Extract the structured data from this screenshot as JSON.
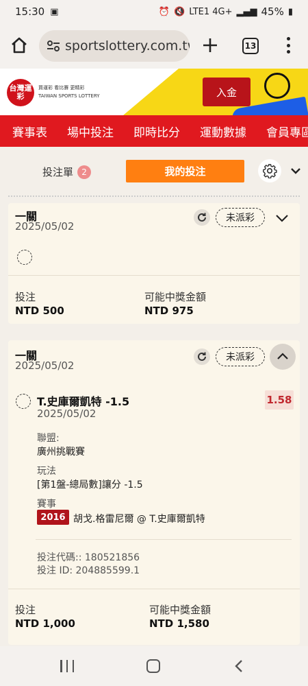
{
  "status_bar": {
    "time": "15:30",
    "network": "LTE1 4G+",
    "battery": "45%"
  },
  "browser": {
    "url": "sportslottery.com.tw",
    "tab_count": "13"
  },
  "site": {
    "logo_text_cn": "台灣運彩",
    "logo_sub": "買運彩 看比賽 更精彩",
    "logo_en": "TAIWAN SPORTS LOTTERY",
    "deposit_label": "入金",
    "nav_items": [
      "賽事表",
      "場中投注",
      "即時比分",
      "運動數據",
      "會員專區"
    ]
  },
  "betslip_tabs": {
    "slip_label": "投注單",
    "slip_count": "2",
    "mybets_label": "我的投注"
  },
  "bets": [
    {
      "type": "一關",
      "date": "2025/05/02",
      "status": "未派彩",
      "stake_label": "投注",
      "stake_value": "NTD 500",
      "payout_label": "可能中獎金額",
      "payout_value": "NTD 975"
    },
    {
      "type": "一關",
      "date": "2025/05/02",
      "status": "未派彩",
      "selection": "T.史庫爾凱特 -1.5",
      "selection_date": "2025/05/02",
      "odds": "1.58",
      "league_label": "聯盟:",
      "league_value": "廣州挑戰賽",
      "market_label": "玩法",
      "market_value": "[第1盤-總局數]讓分 -1.5",
      "event_label": "賽事",
      "event_year": "2016",
      "event_value": "胡戈.格雷尼爾 @ T.史庫爾凱特",
      "bet_code": "投注代碼:: 180521856",
      "bet_id": "投注 ID: 204885599.1",
      "stake_label": "投注",
      "stake_value": "NTD 1,000",
      "payout_label": "可能中獎金額",
      "payout_value": "NTD 1,580"
    }
  ]
}
